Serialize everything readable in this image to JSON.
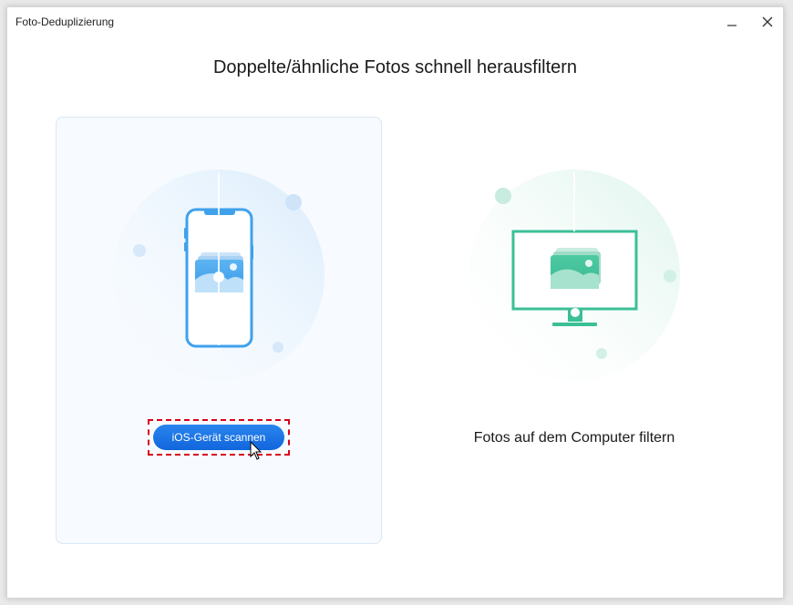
{
  "window": {
    "title": "Foto-Deduplizierung",
    "controls": [
      "minimize-icon",
      "close-icon"
    ]
  },
  "headline": "Doppelte/ähnliche Fotos schnell herausfiltern",
  "options": {
    "ios": {
      "button_label": "iOS-Gerät scannen",
      "icon": "phone-photo-icon",
      "state": "selected"
    },
    "pc": {
      "label": "Fotos auf dem Computer filtern",
      "icon": "monitor-photo-icon"
    }
  },
  "colors": {
    "accent_blue": "#1a73e8",
    "phone_blue": "#3fa1ec",
    "monitor_green": "#3bbf97",
    "highlight_red": "#d9001b"
  }
}
